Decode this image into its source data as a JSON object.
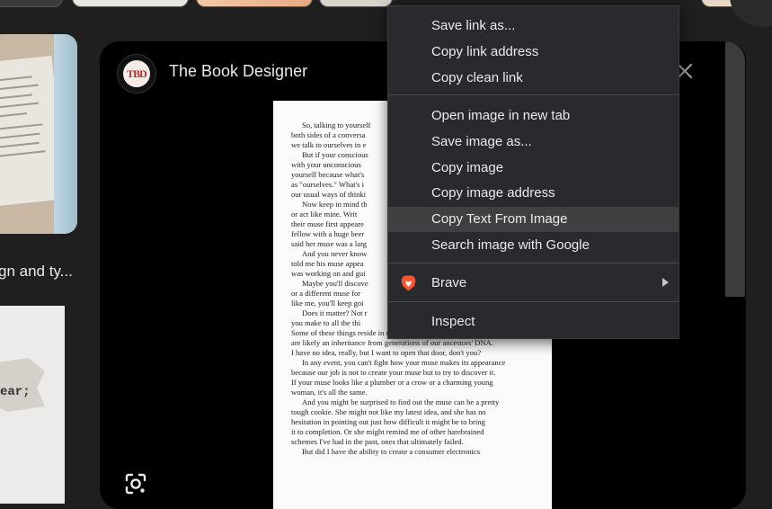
{
  "viewer": {
    "site_name": "The Book Designer",
    "logo_text": "TBD"
  },
  "left_results": {
    "caption": "gn and ty...",
    "snippet": "ear;"
  },
  "book_page": {
    "lines": [
      {
        "text": "So, talking to yourself",
        "indent": true
      },
      {
        "text": "both sides of a conversa",
        "indent": false
      },
      {
        "text": "we talk to ourselves in e",
        "indent": false
      },
      {
        "text": "But if your conscious",
        "indent": true
      },
      {
        "text": "with your unconscious",
        "indent": false
      },
      {
        "text": "yourself because what's",
        "indent": false
      },
      {
        "text": "as \"ourselves.\" What's i",
        "indent": false
      },
      {
        "text": "our usual ways of thinki",
        "indent": false
      },
      {
        "text": "Now keep in mind th",
        "indent": true
      },
      {
        "text": "or act like mine. Writ",
        "indent": false
      },
      {
        "text": "their muse first appeare",
        "indent": false
      },
      {
        "text": "fellow with a huge beer",
        "indent": false
      },
      {
        "text": "said her muse was a larg",
        "indent": false
      },
      {
        "text": "And you never know",
        "indent": true
      },
      {
        "text": "told me his muse appea",
        "indent": false
      },
      {
        "text": "was working on and gui",
        "indent": false
      },
      {
        "text": "Maybe you'll discove",
        "indent": true
      },
      {
        "text": "or a different muse for",
        "indent": false
      },
      {
        "text": "like me, you'll keep goi",
        "indent": false
      },
      {
        "text": "Does it matter? Not r",
        "indent": true
      },
      {
        "text": "you make to all the thi",
        "indent": false
      },
      {
        "text": "Some of these things reside in our shared cultural memory; others",
        "indent": false
      },
      {
        "text": "are likely an inheritance from generations of our ancestors' DNA.",
        "indent": false
      },
      {
        "text": "I have no idea, really, but I want to open that door, don't you?",
        "indent": false
      },
      {
        "text": "In any event, you can't fight how your muse makes its appearance",
        "indent": true
      },
      {
        "text": "because our job is not to create your muse but to try to discover it.",
        "indent": false
      },
      {
        "text": "If your muse looks like a plumber or a crow or a charming young",
        "indent": false
      },
      {
        "text": "woman, it's all the same.",
        "indent": false
      },
      {
        "text": "And you might be surprised to find out the muse can be a pretty",
        "indent": true
      },
      {
        "text": "tough cookie. She might not like my latest idea, and she has no",
        "indent": false
      },
      {
        "text": "hesitation in pointing out just how difficult it might be to bring",
        "indent": false
      },
      {
        "text": "it to completion. Or she might remind me of other harebrained",
        "indent": false
      },
      {
        "text": "schemes I've had in the past, ones that ultimately failed.",
        "indent": false
      },
      {
        "text": "But did I have the ability to create a consumer electronics",
        "indent": true
      }
    ],
    "footer_dots": "..."
  },
  "context_menu": {
    "save_link_as": "Save link as...",
    "copy_link_address": "Copy link address",
    "copy_clean_link": "Copy clean link",
    "open_image_new_tab": "Open image in new tab",
    "save_image_as": "Save image as...",
    "copy_image": "Copy image",
    "copy_image_address": "Copy image address",
    "copy_text_from_image": "Copy Text From Image",
    "search_image_google": "Search image with Google",
    "brave": "Brave",
    "inspect": "Inspect"
  },
  "icons": {
    "close": "close-icon",
    "lens": "google-lens-icon",
    "brave": "brave-lion-icon",
    "submenu": "chevron-right-icon"
  },
  "colors": {
    "menu_bg": "#292a2d",
    "menu_hover": "#3f4042",
    "viewer_bg": "#000000",
    "page_bg": "#1f1f1f",
    "brave_orange": "#fb542b"
  }
}
